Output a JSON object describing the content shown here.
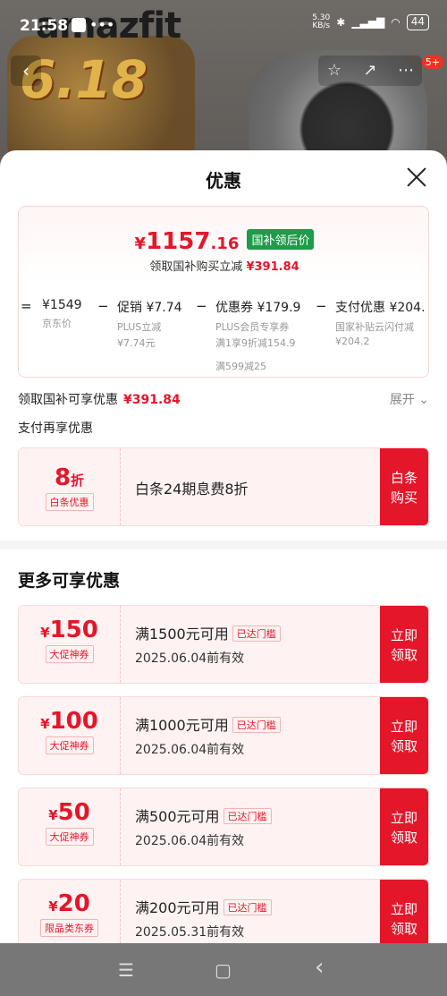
{
  "status": {
    "time": "21:58",
    "net_speed": "5.30\nKB/s",
    "signal": "HD",
    "battery": "44"
  },
  "background": {
    "brand": "amazfit",
    "promo": "6.18"
  },
  "nav": {
    "badge": "5+"
  },
  "sheet": {
    "title": "优惠",
    "price": {
      "yen": "¥",
      "integer": "1157",
      "decimal": ".16",
      "tag": "国补领后价",
      "subtitle": "领取国补购买立减",
      "subtitle_amount": "¥391.84"
    },
    "breakdown": [
      {
        "op": "=",
        "line1": "¥1549",
        "line2": "京东价",
        "line3": "",
        "line4": ""
      },
      {
        "op": "−",
        "line1": "促销 ¥7.74",
        "line2": "PLUS立减",
        "line3": "¥7.74元",
        "line4": ""
      },
      {
        "op": "−",
        "line1": "优惠券 ¥179.9",
        "line2": "PLUS会员专享券",
        "line3": "满1享9折减154.9",
        "line4": "满599减25"
      },
      {
        "op": "−",
        "line1": "支付优惠 ¥204.",
        "line2": "国家补贴云闪付减",
        "line3": "¥204.2",
        "line4": ""
      }
    ],
    "avail_text": "领取国补可享优惠",
    "avail_amount": "¥391.84",
    "expand_label": "展开 ⌄",
    "pay_label": "支付再享优惠",
    "pay_coupon": {
      "amount": "8",
      "unit": "折",
      "tag": "白条优惠",
      "title": "白条24期息费8折",
      "action": "白条购买"
    },
    "more_title": "更多可享优惠",
    "coupons": [
      {
        "yen": "¥",
        "amount": "150",
        "tag": "大促神券",
        "title": "满1500元可用",
        "badge": "已达门槛",
        "date": "2025.06.04前有效",
        "action": "立即领取"
      },
      {
        "yen": "¥",
        "amount": "100",
        "tag": "大促神券",
        "title": "满1000元可用",
        "badge": "已达门槛",
        "date": "2025.06.04前有效",
        "action": "立即领取"
      },
      {
        "yen": "¥",
        "amount": "50",
        "tag": "大促神券",
        "title": "满500元可用",
        "badge": "已达门槛",
        "date": "2025.06.04前有效",
        "action": "立即领取"
      },
      {
        "yen": "¥",
        "amount": "20",
        "tag": "限品类东券",
        "title": "满200元可用",
        "badge": "已达门槛",
        "date": "2025.05.31前有效",
        "action": "立即领取"
      }
    ]
  },
  "system_nav": {
    "menu": "☰",
    "home": "▢",
    "back": "‹"
  }
}
